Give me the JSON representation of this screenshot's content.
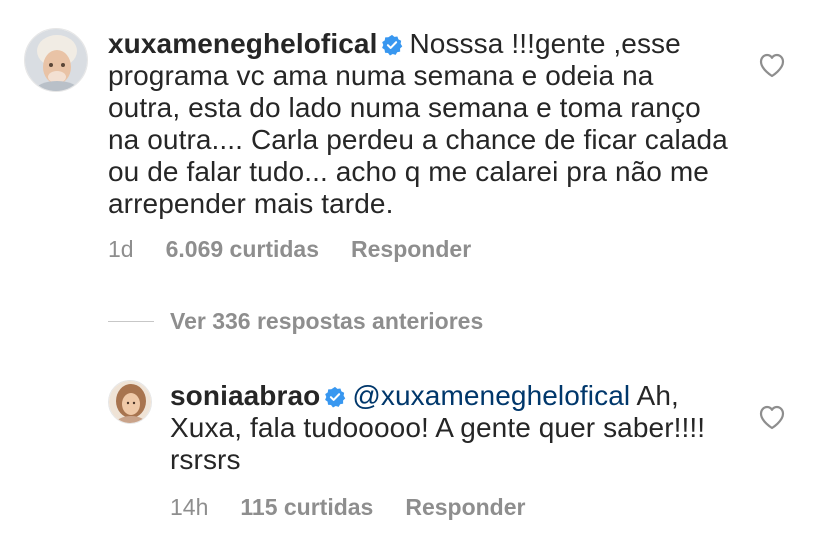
{
  "comments": [
    {
      "username": "xuxameneghelofical",
      "verified": true,
      "mention": "",
      "text": "Nosssa !!!gente ,esse programa vc ama numa semana e odeia na outra, esta do lado numa semana e toma ranço na outra.... Carla perdeu a chance de ficar calada ou de falar tudo... acho q me calarei pra não me arrepender mais tarde.",
      "time": "1d",
      "likes": "6.069 curtidas",
      "reply_label": "Responder",
      "avatar_icon": "avatar-xuxa-photo"
    },
    {
      "username": "soniaabrao",
      "verified": true,
      "mention": "@xuxameneghelofical",
      "text": "Ah, Xuxa, fala tudooooo! A gente quer saber!!!! rsrsrs",
      "time": "14h",
      "likes": "115 curtidas",
      "reply_label": "Responder",
      "avatar_icon": "avatar-sonia-photo"
    }
  ],
  "view_replies": {
    "label": "Ver 336 respostas anteriores"
  },
  "colors": {
    "text": "#262626",
    "secondary": "#8e8e8e",
    "verified_blue": "#3897f0",
    "mention": "#00376b"
  }
}
